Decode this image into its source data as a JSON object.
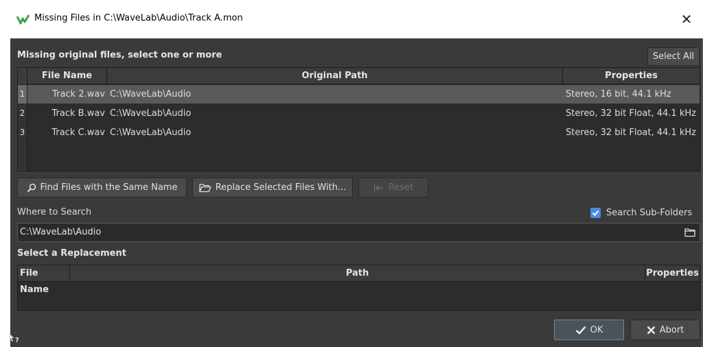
{
  "window": {
    "title": "Missing Files in C:\\WaveLab\\Audio\\Track A.mon",
    "close_glyph": "✕"
  },
  "missing": {
    "heading": "Missing original files, select one or more",
    "select_all_label": "Select All",
    "columns": [
      "File Name",
      "Original Path",
      "Properties"
    ],
    "rows": [
      {
        "index": "1",
        "file_name": "Track 2.wav",
        "path": "C:\\WaveLab\\Audio",
        "properties": "Stereo, 16 bit, 44.1 kHz",
        "selected": true
      },
      {
        "index": "2",
        "file_name": "Track B.wav",
        "path": "C:\\WaveLab\\Audio",
        "properties": "Stereo, 32 bit Float, 44.1 kHz",
        "selected": false
      },
      {
        "index": "3",
        "file_name": "Track C.wav",
        "path": "C:\\WaveLab\\Audio",
        "properties": "Stereo, 32 bit Float, 44.1 kHz",
        "selected": false
      }
    ]
  },
  "actions": {
    "find_label": "Find Files with the Same Name",
    "replace_label": "Replace Selected Files With...",
    "reset_label": "Reset"
  },
  "search": {
    "where_label": "Where to Search",
    "subfolders_label": "Search Sub-Folders",
    "subfolders_checked": true,
    "path_value": "C:\\WaveLab\\Audio"
  },
  "replacement": {
    "heading": "Select a Replacement",
    "columns": [
      "File Name",
      "Path",
      "Properties"
    ]
  },
  "footer": {
    "ok_label": "OK",
    "abort_label": "Abort"
  },
  "icons": {
    "app": "wavelab-logo-icon",
    "find": "magnifier-icon",
    "replace": "folder-open-icon",
    "reset": "reset-arrow-icon",
    "browse": "folder-icon",
    "ok": "checkmark-icon",
    "abort": "x-icon",
    "help": "whats-this-help-icon"
  },
  "colors": {
    "dialog_bg": "#3a3a3a",
    "table_bg": "#2c2c2c",
    "selected_row": "#5a5a5a",
    "checkbox_accent": "#4a8be0",
    "ok_border": "#6b8aa6"
  }
}
